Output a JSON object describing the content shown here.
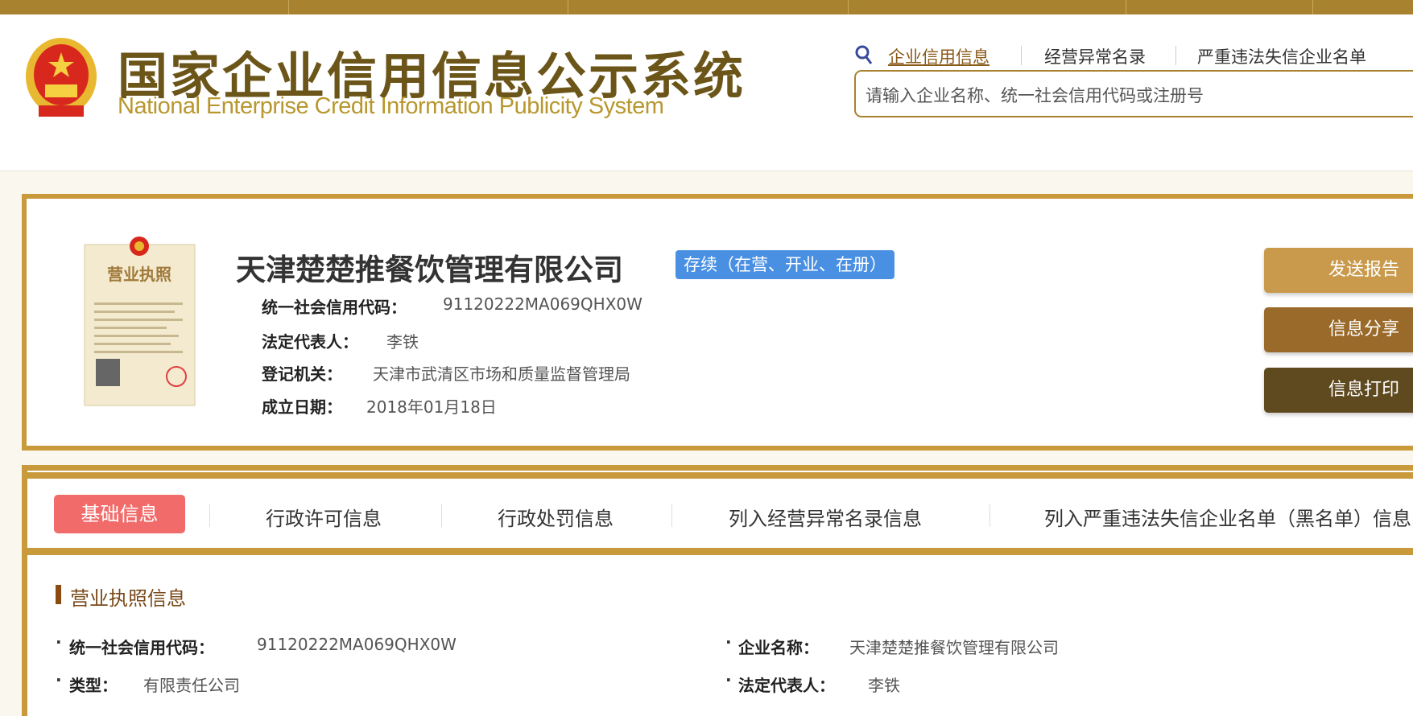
{
  "header": {
    "title_cn": "国家企业信用信息公示系统",
    "title_en": "National Enterprise Credit Information Publicity System",
    "nav": [
      {
        "label": "企业信用信息"
      },
      {
        "label": "经营异常名录"
      },
      {
        "label": "严重违法失信企业名单"
      }
    ],
    "search_placeholder": "请输入企业名称、统一社会信用代码或注册号"
  },
  "company": {
    "name": "天津楚楚推餐饮管理有限公司",
    "status": "存续（在营、开业、在册）",
    "fields": [
      {
        "label": "统一社会信用代码：",
        "value": "91120222MA069QHX0W"
      },
      {
        "label": "法定代表人：",
        "value": "李铁"
      },
      {
        "label": "登记机关：",
        "value": "天津市武清区市场和质量监督管理局"
      },
      {
        "label": "成立日期：",
        "value": "2018年01月18日"
      }
    ],
    "license_image_text": "营业执照"
  },
  "actions": [
    {
      "label": "发送报告",
      "color": "#c99a4c"
    },
    {
      "label": "信息分享",
      "color": "#9a6a2a"
    },
    {
      "label": "信息打印",
      "color": "#5f4a20"
    }
  ],
  "tabs": [
    {
      "label": "基础信息"
    },
    {
      "label": "行政许可信息"
    },
    {
      "label": "行政处罚信息"
    },
    {
      "label": "列入经营异常名录信息"
    },
    {
      "label": "列入严重违法失信企业名单（黑名单）信息"
    }
  ],
  "section": {
    "title": "营业执照信息",
    "rows": [
      [
        {
          "label": "统一社会信用代码：",
          "value": "91120222MA069QHX0W"
        },
        {
          "label": "企业名称：",
          "value": "天津楚楚推餐饮管理有限公司"
        }
      ],
      [
        {
          "label": "类型：",
          "value": "有限责任公司"
        },
        {
          "label": "法定代表人：",
          "value": "李铁"
        }
      ]
    ]
  },
  "colors": {
    "gold": "#c99a3c",
    "topbar": "#a98230",
    "active_tab": "#f26b6b",
    "status_badge": "#4a90e2"
  }
}
